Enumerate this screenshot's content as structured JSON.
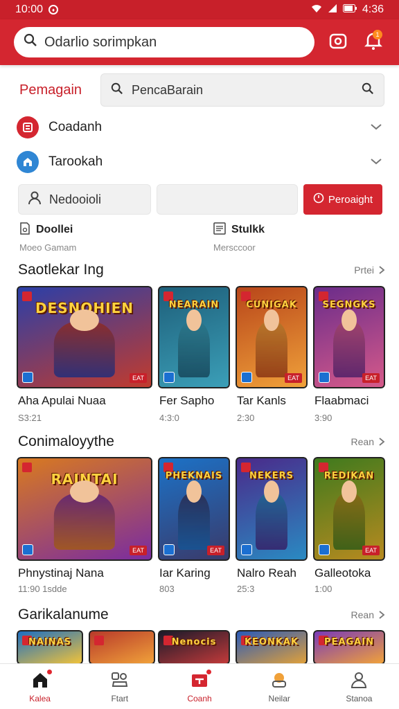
{
  "status": {
    "time": "10:00",
    "battery": "4:36"
  },
  "topbar": {
    "search_placeholder": "Odarlio sorimpkan"
  },
  "filter": {
    "title": "Pemagain",
    "search_placeholder": "PencaBarain",
    "dropdowns": [
      {
        "label": "Coadanh",
        "color": "#d42630",
        "icon": "game-icon"
      },
      {
        "label": "Tarookah",
        "color": "#2f86d4",
        "icon": "store-icon"
      }
    ],
    "input_label": "Nedooioli",
    "button_label": "Peroaight",
    "options": [
      {
        "title": "Doollei",
        "subtitle": "Moeo Gamam"
      },
      {
        "title": "Stulkk",
        "subtitle": "Mersccoor"
      }
    ]
  },
  "sections": [
    {
      "title": "Saotlekar Ing",
      "more": "Prtei",
      "cards": [
        {
          "name": "Aha Apulai Nuaa",
          "sub": "S3:21",
          "logo": "DESNOHIEN",
          "rating": "EAT",
          "colors": [
            "#2b3fa8",
            "#c23b2d"
          ]
        },
        {
          "name": "Fer Sapho",
          "sub": "4:3:0",
          "logo": "NEARAIN",
          "rating": "",
          "colors": [
            "#1e5f7a",
            "#3b9fb8"
          ]
        },
        {
          "name": "Tar Kanls",
          "sub": "2:30",
          "logo": "CUNIGAK",
          "rating": "EAT",
          "colors": [
            "#b8461a",
            "#f0a13a"
          ]
        },
        {
          "name": "Flaabmaci",
          "sub": "3:90",
          "logo": "SEGNGKS",
          "rating": "EAT",
          "colors": [
            "#6a2c8a",
            "#d65a8a"
          ]
        }
      ]
    },
    {
      "title": "Conimaloyythe",
      "more": "Rean",
      "cards": [
        {
          "name": "Phnystinaj Nana",
          "sub": "11:90 1sdde",
          "logo": "RAINTAI",
          "rating": "EAT",
          "colors": [
            "#d97a1f",
            "#7a2ca0"
          ]
        },
        {
          "name": "Iar Karing",
          "sub": "803",
          "logo": "PHEKNAIS",
          "rating": "EAT",
          "colors": [
            "#1c72c7",
            "#3a3a6a"
          ]
        },
        {
          "name": "Nalro Reah",
          "sub": "25:3",
          "logo": "NEKERS",
          "rating": "",
          "colors": [
            "#4a2a8a",
            "#2a8ac2"
          ]
        },
        {
          "name": "Galleotoka",
          "sub": "1:00",
          "logo": "REDIKAN",
          "rating": "EAT",
          "colors": [
            "#3f7a1e",
            "#b88a1f"
          ]
        }
      ]
    },
    {
      "title": "Garikalanume",
      "more": "Rean",
      "cards": [
        {
          "name": "",
          "sub": "",
          "logo": "NAINAS",
          "rating": "",
          "colors": [
            "#1d6fc2",
            "#f0c23a"
          ]
        },
        {
          "name": "",
          "sub": "",
          "logo": "",
          "rating": "",
          "colors": [
            "#b83a2a",
            "#f0a13a"
          ]
        },
        {
          "name": "",
          "sub": "",
          "logo": "Nenocis",
          "rating": "",
          "colors": [
            "#1a1a2a",
            "#c23a3a"
          ]
        },
        {
          "name": "",
          "sub": "",
          "logo": "KEONKAK",
          "rating": "",
          "colors": [
            "#2a5ab8",
            "#e0a03a"
          ]
        },
        {
          "name": "",
          "sub": "",
          "logo": "PEAGAIN",
          "rating": "",
          "colors": [
            "#7a3ab8",
            "#f0a13a"
          ]
        }
      ]
    }
  ],
  "nav": [
    {
      "label": "Kalea",
      "icon": "home-icon",
      "active": false,
      "dot": true
    },
    {
      "label": "Ftart",
      "icon": "controller-icon",
      "active": false,
      "dot": false
    },
    {
      "label": "Coanh",
      "icon": "store-icon",
      "active": true,
      "dot": true
    },
    {
      "label": "Neilar",
      "icon": "chat-icon",
      "active": false,
      "dot": false
    },
    {
      "label": "Stanoa",
      "icon": "profile-icon",
      "active": false,
      "dot": false
    }
  ],
  "colors": {
    "brand": "#d42630",
    "accent": "#c8202a"
  }
}
